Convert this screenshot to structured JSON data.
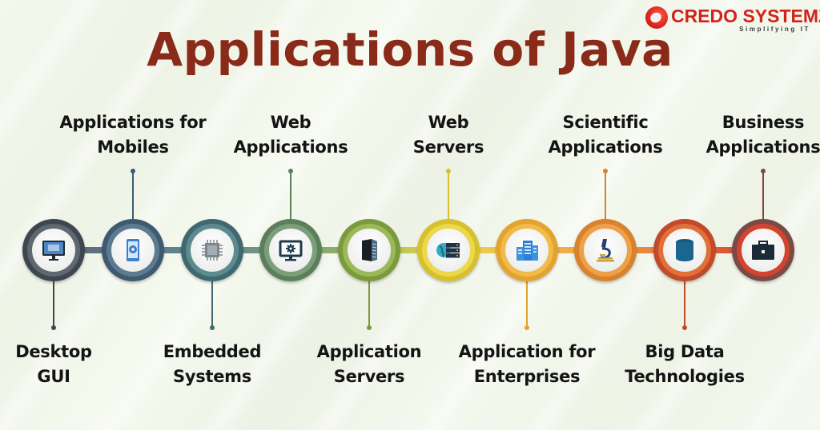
{
  "title": "Applications of Java",
  "brand": {
    "name": "CREDO SYSTEMZ",
    "tagline": "Simplifying IT",
    "color": "#d2231b"
  },
  "items": [
    {
      "label_line1": "Desktop",
      "label_line2": "GUI",
      "position": "bottom",
      "icon": "desktop-monitor-icon",
      "color": "#3f4650",
      "accent": "#5f6771"
    },
    {
      "label_line1": "Applications for",
      "label_line2": "Mobiles",
      "position": "top",
      "icon": "mobile-gear-icon",
      "color": "#3e5a70",
      "accent": "#5d7a8f"
    },
    {
      "label_line1": "Embedded",
      "label_line2": "Systems",
      "position": "bottom",
      "icon": "chip-icon",
      "color": "#3f6870",
      "accent": "#5e8a8f"
    },
    {
      "label_line1": "Web",
      "label_line2": "Applications",
      "position": "top",
      "icon": "monitor-gear-icon",
      "color": "#5b7f5a",
      "accent": "#7c9e7a"
    },
    {
      "label_line1": "Application",
      "label_line2": "Servers",
      "position": "bottom",
      "icon": "server-rack-icon",
      "color": "#7a9a3c",
      "accent": "#9cb95a"
    },
    {
      "label_line1": "Web",
      "label_line2": "Servers",
      "position": "top",
      "icon": "globe-server-icon",
      "color": "#d6c12c",
      "accent": "#ecd84a"
    },
    {
      "label_line1": "Application for",
      "label_line2": "Enterprises",
      "position": "bottom",
      "icon": "buildings-icon",
      "color": "#e3a32e",
      "accent": "#f0bb4a"
    },
    {
      "label_line1": "Scientific",
      "label_line2": "Applications",
      "position": "top",
      "icon": "microscope-icon",
      "color": "#d9822d",
      "accent": "#eea048"
    },
    {
      "label_line1": "Big Data",
      "label_line2": "Technologies",
      "position": "bottom",
      "icon": "database-icon",
      "color": "#c2492a",
      "accent": "#e07038"
    },
    {
      "label_line1": "Business",
      "label_line2": "Applications",
      "position": "top",
      "icon": "briefcase-icon",
      "color": "#7c4a44",
      "accent": "#d5432e"
    }
  ]
}
